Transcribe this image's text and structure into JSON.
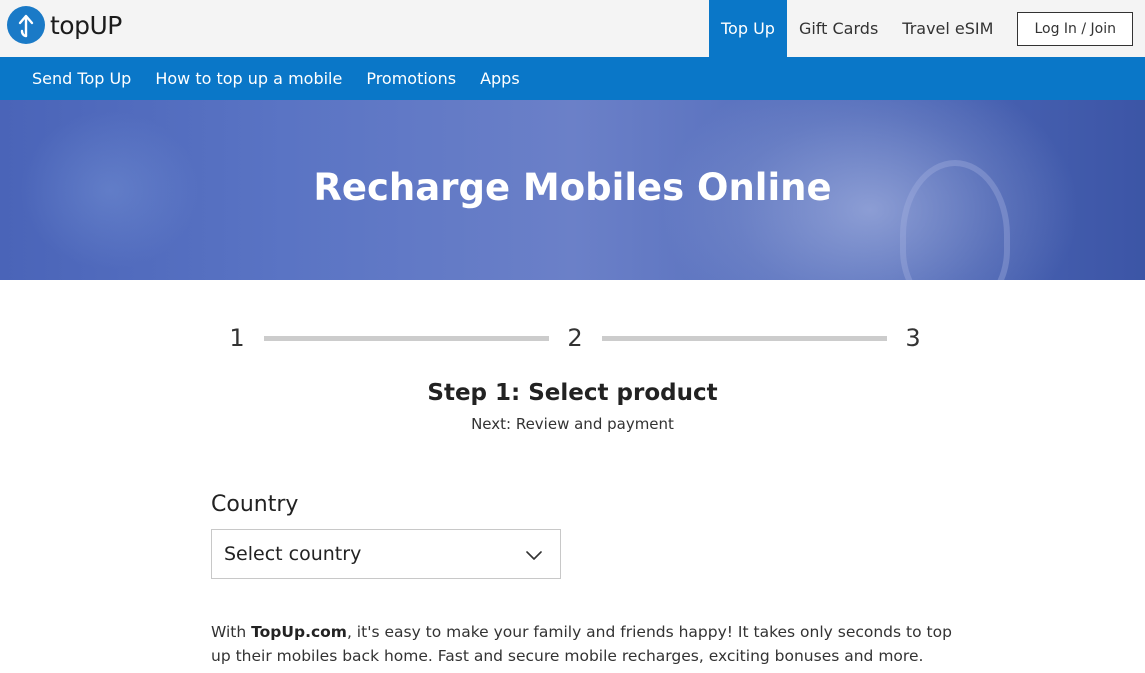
{
  "header": {
    "logo_text": "topUP",
    "nav": [
      {
        "label": "Top Up",
        "active": true
      },
      {
        "label": "Gift Cards",
        "active": false
      },
      {
        "label": "Travel eSIM",
        "active": false
      }
    ],
    "login_label": "Log In / Join"
  },
  "subnav": {
    "items": [
      "Send Top Up",
      "How to top up a mobile",
      "Promotions",
      "Apps"
    ]
  },
  "hero": {
    "title": "Recharge Mobiles Online"
  },
  "steps": {
    "numbers": [
      "1",
      "2",
      "3"
    ],
    "title": "Step 1: Select product",
    "next": "Next: Review and payment"
  },
  "country": {
    "label": "Country",
    "placeholder": "Select country"
  },
  "description": {
    "brand": "TopUp.com",
    "prefix": "With ",
    "suffix": ", it's easy to make your family and friends happy! It takes only seconds to top up their mobiles back home. Fast and secure mobile recharges, exciting bonuses and more."
  },
  "colors": {
    "brand_blue": "#0a77c8",
    "topbar_bg": "#f4f4f4",
    "step_line": "#cccccc"
  }
}
